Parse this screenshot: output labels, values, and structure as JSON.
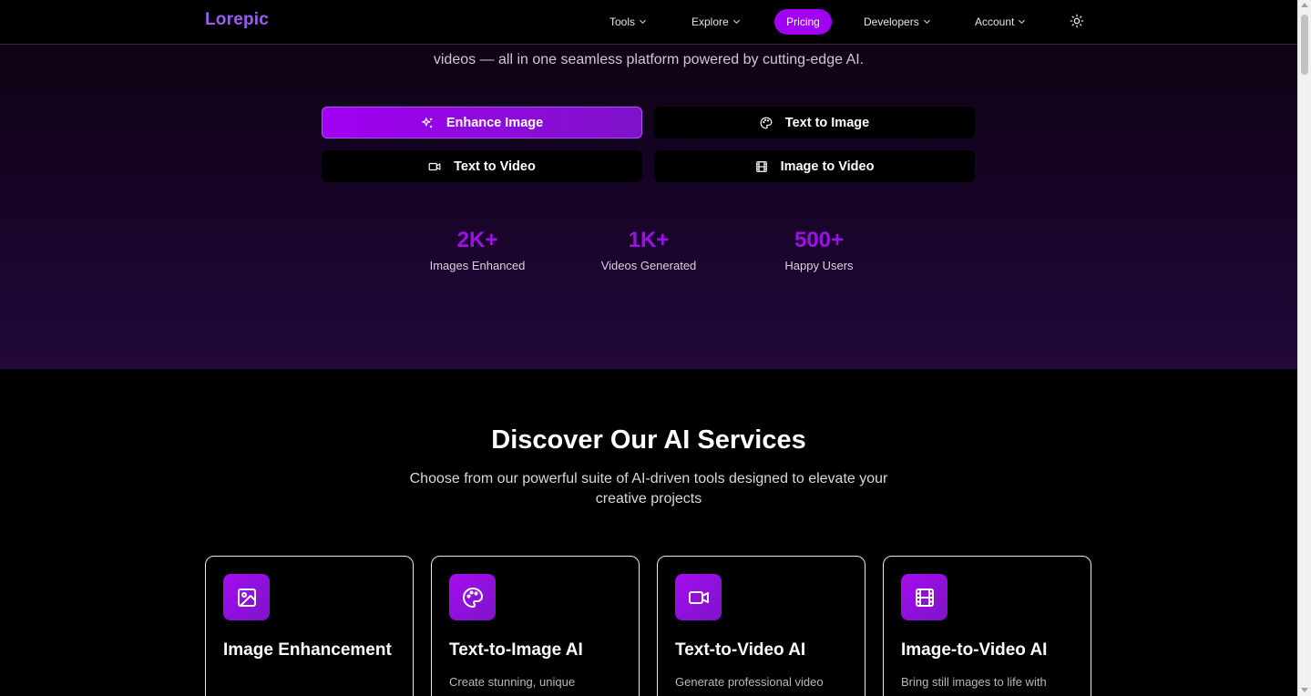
{
  "header": {
    "logo": "Lorepic",
    "nav": {
      "tools": "Tools",
      "explore": "Explore",
      "pricing": "Pricing",
      "developers": "Developers",
      "account": "Account"
    }
  },
  "hero": {
    "subtitle": "videos — all in one seamless platform powered by cutting-edge AI.",
    "tools": [
      {
        "label": "Enhance Image",
        "icon": "sparkles-icon",
        "active": true
      },
      {
        "label": "Text to Image",
        "icon": "palette-icon",
        "active": false
      },
      {
        "label": "Text to Video",
        "icon": "video-icon",
        "active": false
      },
      {
        "label": "Image to Video",
        "icon": "film-icon",
        "active": false
      }
    ],
    "stats": [
      {
        "value": "2K+",
        "label": "Images Enhanced"
      },
      {
        "value": "1K+",
        "label": "Videos Generated"
      },
      {
        "value": "500+",
        "label": "Happy Users"
      }
    ]
  },
  "services": {
    "title": "Discover Our AI Services",
    "subtitle": "Choose from our powerful suite of AI-driven tools designed to elevate your creative projects",
    "cards": [
      {
        "title": "Image Enhancement",
        "description": "",
        "icon": "image-icon"
      },
      {
        "title": "Text-to-Image AI",
        "description": "Create stunning, unique",
        "icon": "palette-icon"
      },
      {
        "title": "Text-to-Video AI",
        "description": "Generate professional video",
        "icon": "video-icon"
      },
      {
        "title": "Image-to-Video AI",
        "description": "Bring still images to life with",
        "icon": "film-icon"
      }
    ]
  },
  "colors": {
    "accent": "#a100f2",
    "logo": "#9b5cf6",
    "stat_value": "#9d10e8"
  }
}
